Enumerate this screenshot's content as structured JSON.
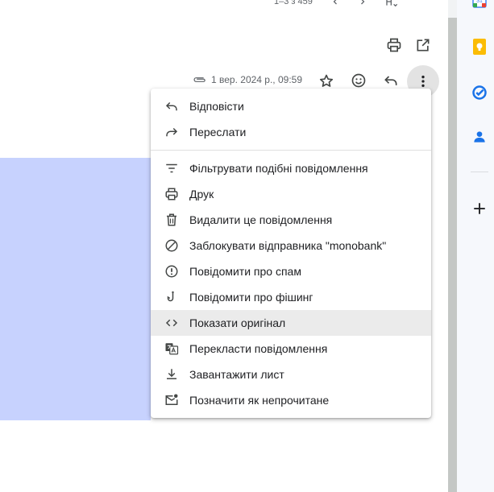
{
  "topbar": {
    "page_count": "1–3 з 459"
  },
  "message_header": {
    "date": "1 вер. 2024 р., 09:59",
    "icons": [
      "print-icon",
      "open-in-new-icon",
      "attachment-icon",
      "star-icon",
      "emoji-icon",
      "reply-icon",
      "more-vert-icon"
    ]
  },
  "context_menu": {
    "items": [
      {
        "label": "Відповісти",
        "icon": "reply-icon"
      },
      {
        "label": "Переслати",
        "icon": "forward-icon"
      },
      {
        "label": "Фільтрувати подібні повідомлення",
        "icon": "filter-icon"
      },
      {
        "label": "Друк",
        "icon": "print-icon"
      },
      {
        "label": "Видалити це повідомлення",
        "icon": "trash-icon"
      },
      {
        "label": "Заблокувати відправника \"monobank\"",
        "icon": "block-icon"
      },
      {
        "label": "Повідомити про спам",
        "icon": "report-icon"
      },
      {
        "label": "Повідомити про фішинг",
        "icon": "phishing-icon"
      },
      {
        "label": "Показати оригінал",
        "icon": "code-icon",
        "highlighted": true
      },
      {
        "label": "Перекласти повідомлення",
        "icon": "translate-icon"
      },
      {
        "label": "Завантажити лист",
        "icon": "download-icon"
      },
      {
        "label": "Позначити як непрочитане",
        "icon": "mark-unread-icon"
      }
    ]
  },
  "side_panel": {
    "apps": [
      "calendar-icon",
      "keep-icon",
      "tasks-icon",
      "contacts-icon",
      "add-icon"
    ]
  },
  "colors": {
    "highlight_block": "#c7d2fe",
    "menu_hover": "#ebebeb",
    "tasks_blue": "#1a73e8",
    "keep_yellow": "#fbbc04"
  }
}
